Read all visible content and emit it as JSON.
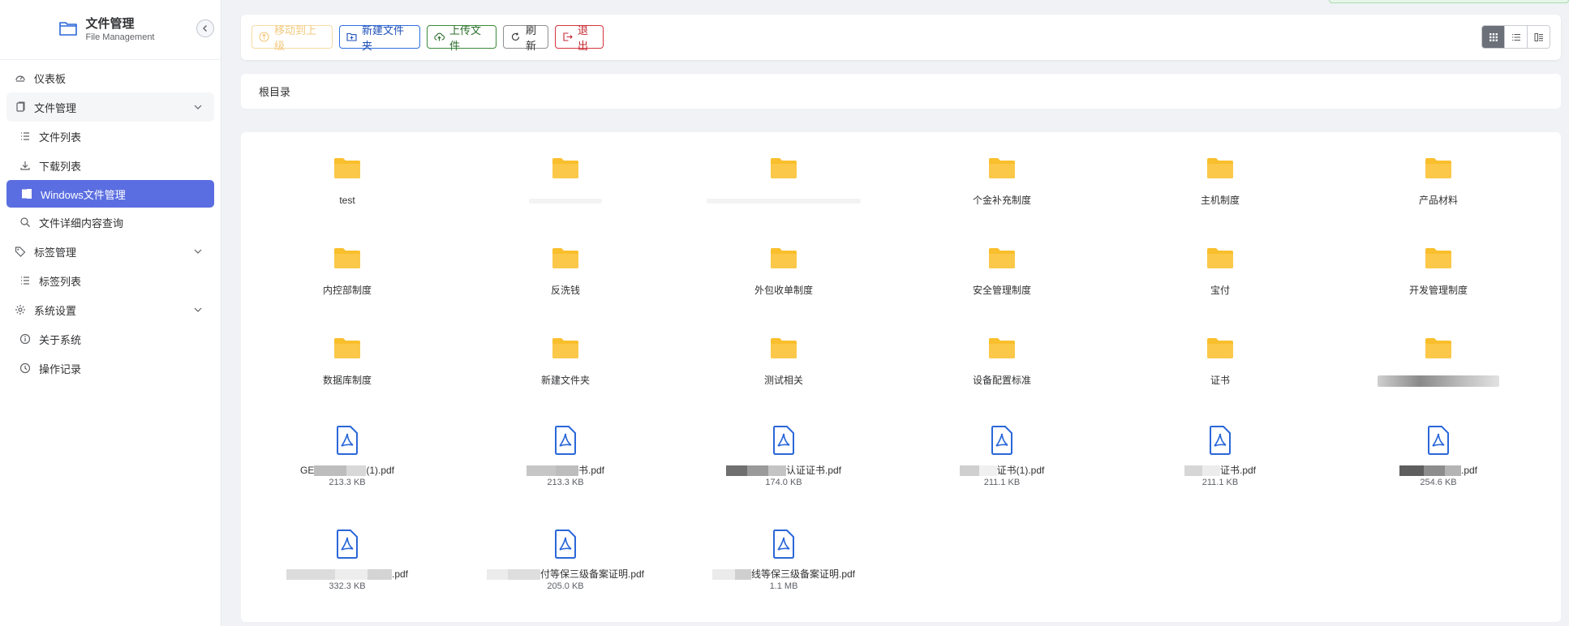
{
  "sidebar": {
    "title": "文件管理",
    "subtitle": "File Management",
    "menu": [
      {
        "label": "仪表板",
        "icon": "dashboard-icon"
      },
      {
        "label": "文件管理",
        "icon": "document-icon"
      },
      {
        "label": "文件列表",
        "icon": "list-icon"
      },
      {
        "label": "下载列表",
        "icon": "download-icon"
      },
      {
        "label": "Windows文件管理",
        "icon": "windows-icon"
      },
      {
        "label": "文件详细内容查询",
        "icon": "search-icon"
      },
      {
        "label": "标签管理",
        "icon": "tag-icon"
      },
      {
        "label": "标签列表",
        "icon": "list-icon"
      },
      {
        "label": "系统设置",
        "icon": "gear-icon"
      },
      {
        "label": "关于系统",
        "icon": "info-icon"
      },
      {
        "label": "操作记录",
        "icon": "clock-icon"
      }
    ]
  },
  "toolbar": {
    "move_up_label": "移动到上级",
    "new_folder_label": "新建文件夹",
    "upload_label": "上传文件",
    "refresh_label": "刷新",
    "exit_label": "退出"
  },
  "breadcrumb": "根目录",
  "colors": {
    "accent": "#5b6ee1",
    "folder": "#f9bf2c",
    "pdf": "#2a67d9"
  },
  "files": [
    {
      "name": "test",
      "type": "folder"
    },
    {
      "name": "",
      "type": "folder"
    },
    {
      "name": "",
      "type": "folder"
    },
    {
      "name": "个金补充制度",
      "type": "folder"
    },
    {
      "name": "主机制度",
      "type": "folder"
    },
    {
      "name": "产品材料",
      "type": "folder"
    },
    {
      "name": "内控部制度",
      "type": "folder"
    },
    {
      "name": "反洗钱",
      "type": "folder"
    },
    {
      "name": "外包收单制度",
      "type": "folder"
    },
    {
      "name": "安全管理制度",
      "type": "folder"
    },
    {
      "name": "宝付",
      "type": "folder"
    },
    {
      "name": "开发管理制度",
      "type": "folder"
    },
    {
      "name": "数据库制度",
      "type": "folder"
    },
    {
      "name": "新建文件夹",
      "type": "folder"
    },
    {
      "name": "测试相关",
      "type": "folder"
    },
    {
      "name": "设备配置标准",
      "type": "folder"
    },
    {
      "name": "证书",
      "type": "folder"
    },
    {
      "name": "",
      "type": "folder"
    },
    {
      "name": "GE...(1).pdf",
      "prefix": "GE",
      "suffix": "(1).pdf",
      "type": "pdf",
      "size": "213.3 KB"
    },
    {
      "name": "...书.pdf",
      "prefix": "",
      "suffix": "书.pdf",
      "type": "pdf",
      "size": "213.3 KB"
    },
    {
      "name": "...认证证书.pdf",
      "prefix": "",
      "suffix": "认证证书.pdf",
      "type": "pdf",
      "size": "174.0 KB"
    },
    {
      "name": "...证书(1).pdf",
      "prefix": "",
      "suffix": "证书(1).pdf",
      "type": "pdf",
      "size": "211.1 KB"
    },
    {
      "name": "...证书.pdf",
      "prefix": "",
      "suffix": "证书.pdf",
      "type": "pdf",
      "size": "211.1 KB"
    },
    {
      "name": "....pdf",
      "prefix": "",
      "suffix": ".pdf",
      "type": "pdf",
      "size": "254.6 KB"
    },
    {
      "name": "....pdf",
      "prefix": "",
      "suffix": ".pdf",
      "type": "pdf",
      "size": "332.3 KB"
    },
    {
      "name": "...付等保三级备案证明.pdf",
      "prefix": "",
      "suffix": "付等保三级备案证明.pdf",
      "type": "pdf",
      "size": "205.0 KB"
    },
    {
      "name": "...线等保三级备案证明.pdf",
      "prefix": "",
      "suffix": "线等保三级备案证明.pdf",
      "type": "pdf",
      "size": "1.1 MB"
    }
  ]
}
